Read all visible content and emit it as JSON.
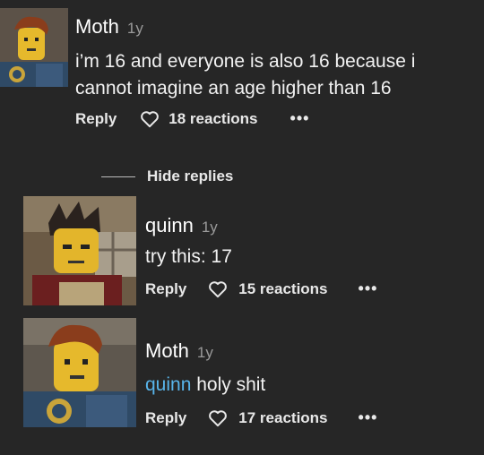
{
  "comments": [
    {
      "author": "Moth",
      "age": "1y",
      "text_lines": [
        "i’m 16 and everyone is also 16 because i",
        "cannot imagine an age higher than 16"
      ],
      "reply_label": "Reply",
      "reactions": "18 reactions",
      "more": "•••"
    }
  ],
  "replies_toggle": {
    "label": "Hide replies"
  },
  "replies": [
    {
      "author": "quinn",
      "age": "1y",
      "text": "try this: 17",
      "reply_label": "Reply",
      "reactions": "15 reactions",
      "more": "•••"
    },
    {
      "author": "Moth",
      "age": "1y",
      "mention": "quinn",
      "text": " holy shit",
      "reply_label": "Reply",
      "reactions": "17 reactions",
      "more": "•••"
    }
  ]
}
